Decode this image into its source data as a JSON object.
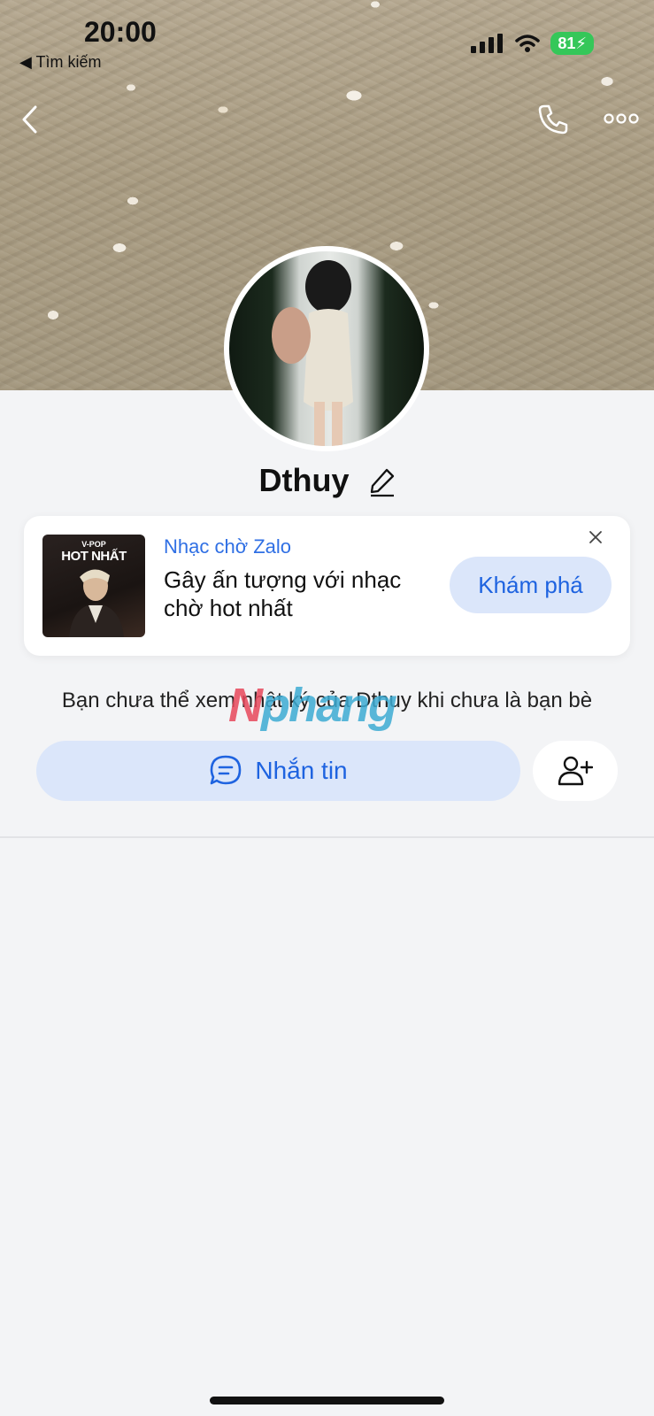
{
  "status_bar": {
    "time": "20:00",
    "back_label": "◀ Tìm kiếm",
    "battery": "81"
  },
  "profile": {
    "name": "Dthuy"
  },
  "promo_card": {
    "album_small": "V-POP",
    "album_big": "HOT NHẤT",
    "label": "Nhạc chờ Zalo",
    "description": "Gây ấn tượng với nhạc chờ hot nhất",
    "button_label": "Khám phá"
  },
  "notice": "Bạn chưa thể xem nhật ký của Dthuy khi chưa là bạn bè",
  "watermark": {
    "part1": "N",
    "part2": "phang"
  },
  "actions": {
    "message_label": "Nhắn tin"
  },
  "colors": {
    "accent": "#1e63e0",
    "accent_soft": "#dbe6fa",
    "battery": "#35c759"
  }
}
